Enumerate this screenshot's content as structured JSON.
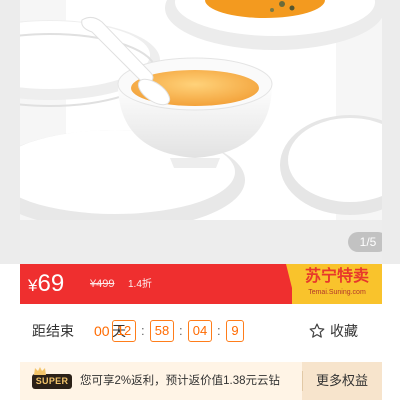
{
  "gallery": {
    "page_indicator": "1/5"
  },
  "price": {
    "currency": "¥",
    "sale_value": "69",
    "original": "¥499",
    "discount": "1.4折",
    "brand_name": "苏宁特卖",
    "brand_url": "Temai.Suning.com",
    "bar_color": "#ef2f2f",
    "brand_color": "#f9c32c"
  },
  "countdown": {
    "label": "距结束",
    "days": "00",
    "days_unit": "天",
    "hours": "12",
    "minutes": "58",
    "seconds": "04",
    "tenths": "9",
    "separator": ":",
    "accent_color": "#ff6a00"
  },
  "favorite": {
    "label": "收藏",
    "icon": "star-outline-icon"
  },
  "super_member": {
    "badge": "SUPER",
    "text": "您可享2%返利，预计返价值1.38元云钻",
    "more_label": "更多权益"
  }
}
